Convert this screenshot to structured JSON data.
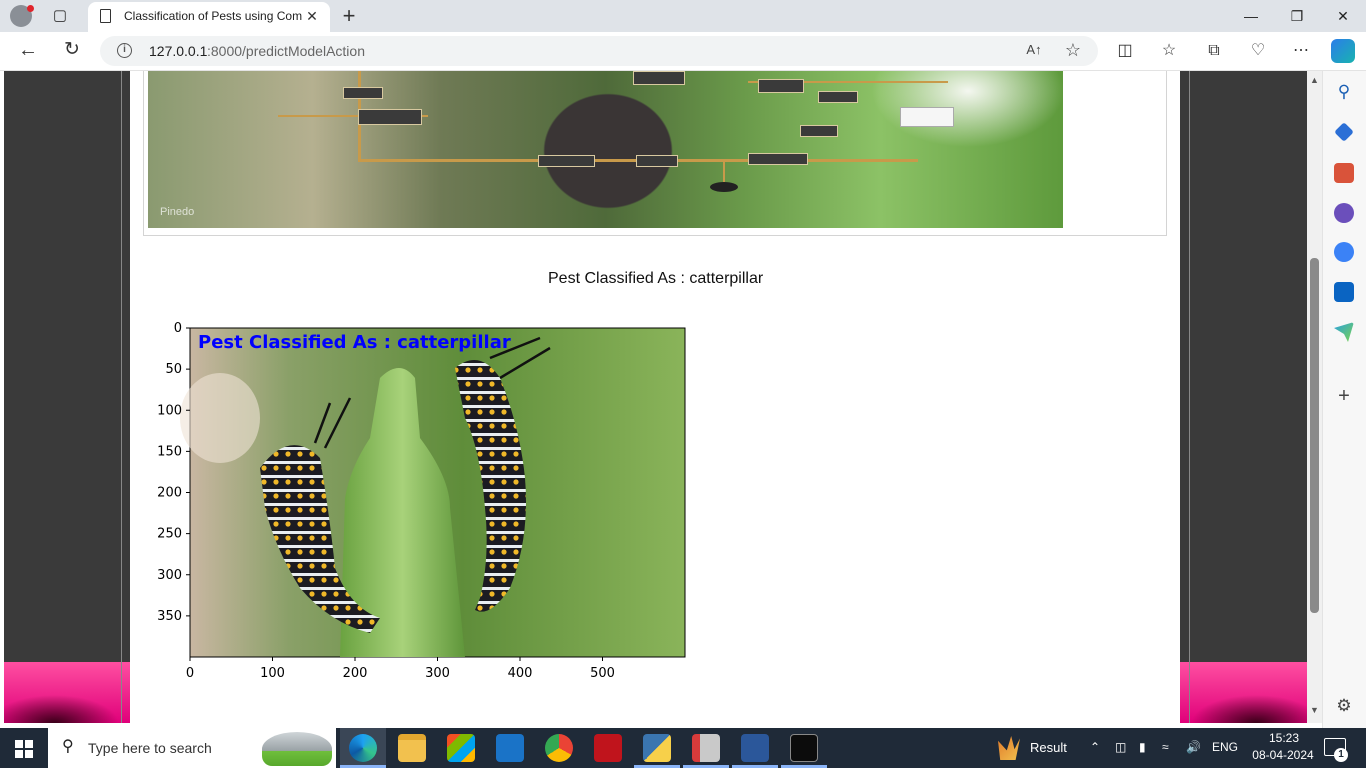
{
  "browser": {
    "tab_title": "Classification of Pests using Com",
    "url_host": "127.0.0.1",
    "url_path": ":8000/predictModelAction",
    "readaloud_label": "A↑"
  },
  "page": {
    "result_text": "Pest Classified As : catterpillar",
    "upload_watermark": "Pinedo"
  },
  "plot": {
    "overlay_label": "Pest Classified As : catterpillar",
    "y_ticks": [
      "0",
      "50",
      "100",
      "150",
      "200",
      "250",
      "300",
      "350"
    ],
    "x_ticks": [
      "0",
      "100",
      "200",
      "300",
      "400",
      "500"
    ]
  },
  "taskbar": {
    "search_placeholder": "Type here to search",
    "running_app_label": "Result",
    "language": "ENG",
    "time": "15:23",
    "date": "08-04-2024",
    "notification_count": "1"
  },
  "colors": {
    "accent": "#0078d4",
    "overlay_text": "#0000ff",
    "pink_band": "#e0007a"
  }
}
